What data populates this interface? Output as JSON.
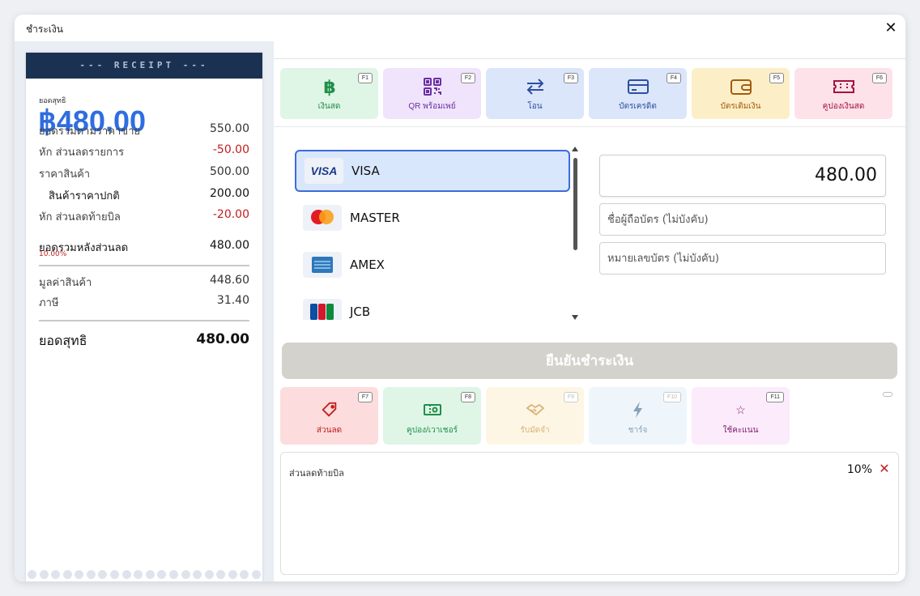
{
  "window": {
    "title": "ชำระเงิน"
  },
  "receipt": {
    "header": "--- RECEIPT ---",
    "net_label_small": "ยอดสุทธิ",
    "net_total_big": "฿480.00",
    "rows": [
      {
        "label": "ยอดรวมตามราคาขาย",
        "value": "550.00"
      },
      {
        "label": "หัก ส่วนลดรายการ",
        "value": "-50.00"
      },
      {
        "label": "ราคาสินค้า",
        "value": "500.00"
      },
      {
        "label": "สินค้าราคาปกติ",
        "value": "200.00"
      },
      {
        "label": "หัก ส่วนลดท้ายบิล",
        "value": "-20.00"
      },
      {
        "label": "ยอดรวมหลังส่วนลด",
        "value": "480.00"
      },
      {
        "label": "มูลค่าสินค้า",
        "value": "448.60"
      },
      {
        "label": "ภาษี",
        "value": "31.40"
      }
    ],
    "bill_discount_pct": "10.00%",
    "final_label": "ยอดสุทธิ",
    "final_value": "480.00"
  },
  "methods": [
    {
      "label": "เงินสด",
      "key": "F1",
      "icon": "baht-icon",
      "bg": "#dff5e6",
      "fg": "#1f8f4a"
    },
    {
      "label": "QR พร้อมเพย์",
      "key": "F2",
      "icon": "qr-code-icon",
      "bg": "#efe4fb",
      "fg": "#6b2fa3"
    },
    {
      "label": "โอน",
      "key": "F3",
      "icon": "transfer-icon",
      "bg": "#dbe6fb",
      "fg": "#2c4f9e"
    },
    {
      "label": "บัตรเครดิต",
      "key": "F4",
      "icon": "credit-card-icon",
      "bg": "#dbe6fb",
      "fg": "#2c4f9e"
    },
    {
      "label": "บัตรเติมเงิน",
      "key": "F5",
      "icon": "wallet-icon",
      "bg": "#fcefc8",
      "fg": "#a55a0c"
    },
    {
      "label": "คูปองเงินสด",
      "key": "F6",
      "icon": "ticket-icon",
      "bg": "#fde2ea",
      "fg": "#a3123f"
    }
  ],
  "cards": [
    {
      "name": "VISA",
      "icon": "visa-icon",
      "selected": true
    },
    {
      "name": "MASTER",
      "icon": "mastercard-icon",
      "selected": false
    },
    {
      "name": "AMEX",
      "icon": "amex-icon",
      "selected": false
    },
    {
      "name": "JCB",
      "icon": "jcb-icon",
      "selected": false
    }
  ],
  "payment": {
    "amount": "480.00",
    "card_holder_placeholder": "ชื่อผู้ถือบัตร (ไม่บังคับ)",
    "card_number_placeholder": "หมายเลขบัตร (ไม่บังคับ)",
    "confirm_label": "ยืนยันชำระเงิน"
  },
  "extras": [
    {
      "label": "ส่วนลด",
      "key": "F7",
      "icon": "tag-icon",
      "bg": "#fcdcdc",
      "fg": "#c21d1d"
    },
    {
      "label": "คูปอง/เวาเชอร์",
      "key": "F8",
      "icon": "voucher-icon",
      "bg": "#dff5e6",
      "fg": "#1f8f4a"
    },
    {
      "label": "รับมัดจำ",
      "key": "F9",
      "icon": "handshake-icon",
      "bg": "#fdf6e4",
      "fg": "#d8b47a"
    },
    {
      "label": "ชาร์จ",
      "key": "F10",
      "icon": "lightning-icon",
      "bg": "#eef6fb",
      "fg": "#8aa0b5"
    },
    {
      "label": "ใช้คะแนน",
      "key": "F11",
      "icon": "star-icon",
      "bg": "#fcebfb",
      "fg": "#7d1a6a"
    }
  ],
  "discount": {
    "label": "ส่วนลดท้ายบิล",
    "value": "10%"
  },
  "colors": {
    "accent": "#2f6de0",
    "receipt_header": "#1b3152",
    "negative": "#c21d1d",
    "selected_card_bg": "#d9e7fd",
    "selected_card_border": "#3d6bd8",
    "confirm_disabled": "#d4d2cd"
  }
}
